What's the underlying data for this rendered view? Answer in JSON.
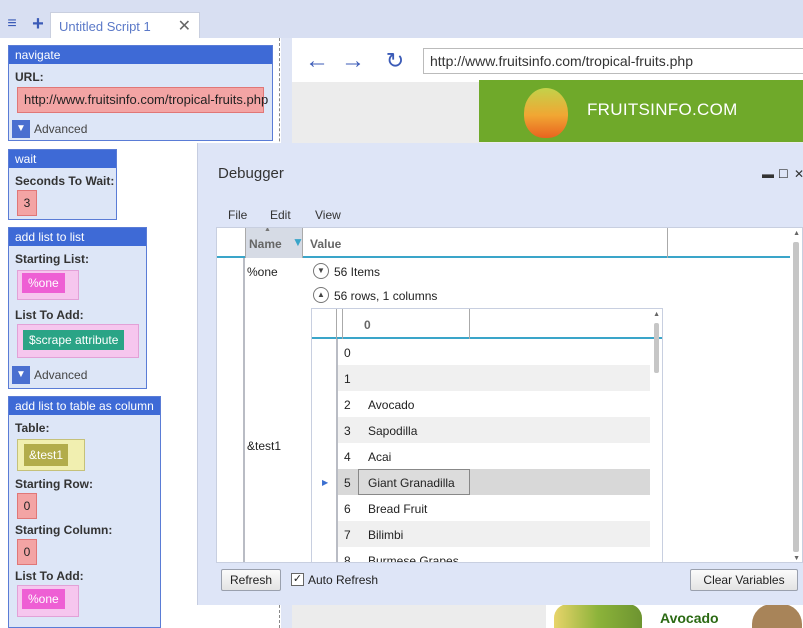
{
  "tabs": {
    "menu_glyph": "≡",
    "add_glyph": "+",
    "script_tab_title": "Untitled Script 1",
    "close_glyph": "✕"
  },
  "script_blocks": {
    "navigate": {
      "title": "navigate",
      "url_label": "URL:",
      "url_value": "http://www.fruitsinfo.com/tropical-fruits.php",
      "advanced_label": "Advanced"
    },
    "wait": {
      "title": "wait",
      "seconds_label": "Seconds To Wait:",
      "seconds_value": "3"
    },
    "add_list_to_list": {
      "title": "add list to list",
      "starting_list_label": "Starting List:",
      "starting_list_value": "%one",
      "list_to_add_label": "List To Add:",
      "list_to_add_value": "$scrape attribute",
      "advanced_label": "Advanced"
    },
    "add_list_to_table": {
      "title": "add list to table as column",
      "table_label": "Table:",
      "table_value": "&test1",
      "starting_row_label": "Starting Row:",
      "starting_row_value": "0",
      "starting_column_label": "Starting Column:",
      "starting_column_value": "0",
      "list_to_add_label": "List To Add:",
      "list_to_add_value": "%one"
    }
  },
  "browser": {
    "back_glyph": "←",
    "forward_glyph": "→",
    "refresh_glyph": "↻",
    "address": "http://www.fruitsinfo.com/tropical-fruits.php",
    "banner_text": "FRUITSINFO.COM",
    "avocado_title": "Avocado"
  },
  "debugger": {
    "title": "Debugger",
    "minimize_glyph": "▬",
    "maximize_glyph": "☐",
    "close_glyph": "✕",
    "menu": [
      "File",
      "Edit",
      "View"
    ],
    "columns": {
      "name": "Name",
      "value": "Value"
    },
    "variables": [
      {
        "name": "%one",
        "summary": "56 Items",
        "expanded": false
      },
      {
        "name": "&test1",
        "summary": "56 rows, 1 columns",
        "expanded": true
      }
    ],
    "inner_table": {
      "column_header": "0",
      "rows": [
        {
          "index": "0",
          "value": ""
        },
        {
          "index": "1",
          "value": ""
        },
        {
          "index": "2",
          "value": "Avocado"
        },
        {
          "index": "3",
          "value": "Sapodilla"
        },
        {
          "index": "4",
          "value": "Acai"
        },
        {
          "index": "5",
          "value": "Giant Granadilla"
        },
        {
          "index": "6",
          "value": "Bread Fruit"
        },
        {
          "index": "7",
          "value": "Bilimbi"
        },
        {
          "index": "8",
          "value": "Burmese Grapes"
        }
      ],
      "selected_index": 5
    },
    "refresh_button": "Refresh",
    "auto_refresh_label": "Auto Refresh",
    "auto_refresh_checked": true,
    "clear_button": "Clear Variables"
  },
  "colors": {
    "block_header": "#3e6ad6",
    "accent_blue": "#3b5bb7",
    "banner_green": "#6fa92a",
    "header_underline": "#3aa5c9"
  }
}
